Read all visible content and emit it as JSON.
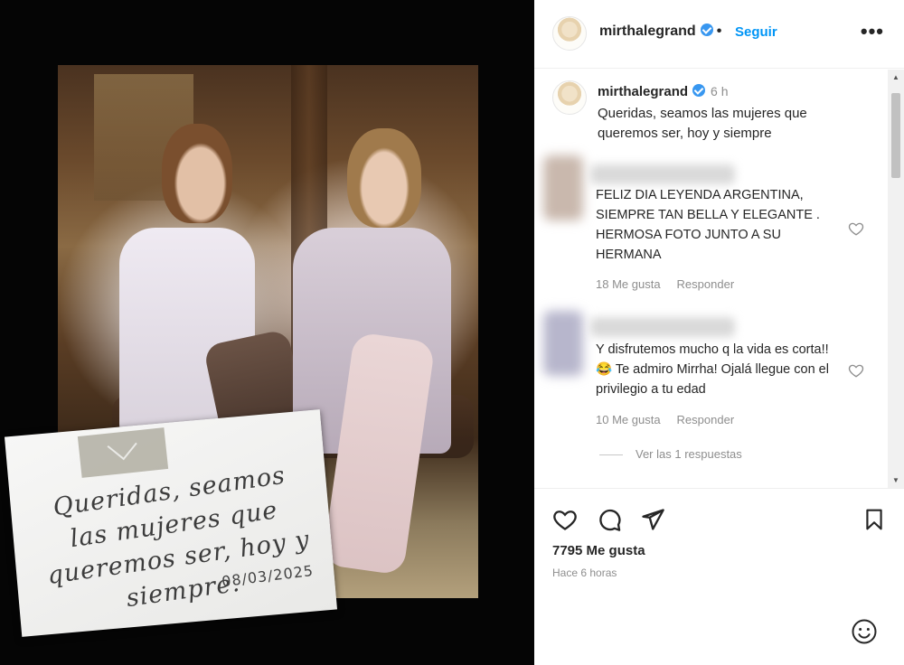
{
  "media": {
    "note_text": "Queridas, seamos las mujeres que queremos ser, hoy y siempre.",
    "note_date": "08/03/2025"
  },
  "header": {
    "username": "mirthalegrand",
    "separator": "•",
    "follow_label": "Seguir",
    "more_label": "•••"
  },
  "caption": {
    "username": "mirthalegrand",
    "time": "6 h",
    "text": "Queridas, seamos las mujeres que queremos ser, hoy y siempre"
  },
  "comments": [
    {
      "text": "FELIZ DIA LEYENDA ARGENTINA, SIEMPRE TAN BELLA Y ELEGANTE . HERMOSA FOTO JUNTO A SU HERMANA",
      "likes": "18 Me gusta",
      "reply_label": "Responder"
    },
    {
      "text": "Y disfrutemos mucho q la vida es corta!! 😂 Te admiro Mirrha! Ojalá llegue con el privilegio a tu edad",
      "likes": "10 Me gusta",
      "reply_label": "Responder"
    }
  ],
  "replies_label": "Ver las 1 respuestas",
  "footer": {
    "likes": "7795 Me gusta",
    "time": "Hace 6 horas"
  },
  "icons": {
    "verified": "verified-badge-icon",
    "like": "heart-icon",
    "comment": "comment-bubble-icon",
    "share": "paper-plane-icon",
    "save": "bookmark-icon",
    "emoji": "smiley-icon"
  },
  "colors": {
    "accent": "#0095f6",
    "verified": "#3897f0",
    "muted": "#8e8e8e"
  }
}
